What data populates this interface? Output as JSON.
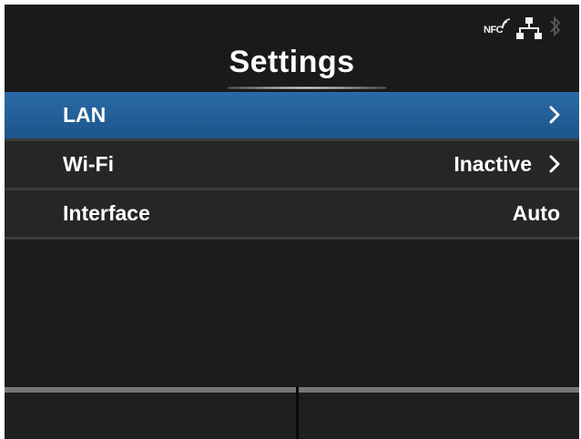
{
  "status_bar": {
    "nfc_label": "NFC",
    "icons": [
      "nfc-icon",
      "lan-icon",
      "bluetooth-icon"
    ]
  },
  "title": "Settings",
  "menu": {
    "items": [
      {
        "label": "LAN",
        "value": "",
        "has_chevron": true,
        "selected": true
      },
      {
        "label": "Wi-Fi",
        "value": "Inactive",
        "has_chevron": true,
        "selected": false
      },
      {
        "label": "Interface",
        "value": "Auto",
        "has_chevron": false,
        "selected": false
      }
    ]
  },
  "colors": {
    "background": "#1a1a1a",
    "selected_row": "#1d558c",
    "text": "#ffffff",
    "soft_key_bar": "#777777"
  }
}
